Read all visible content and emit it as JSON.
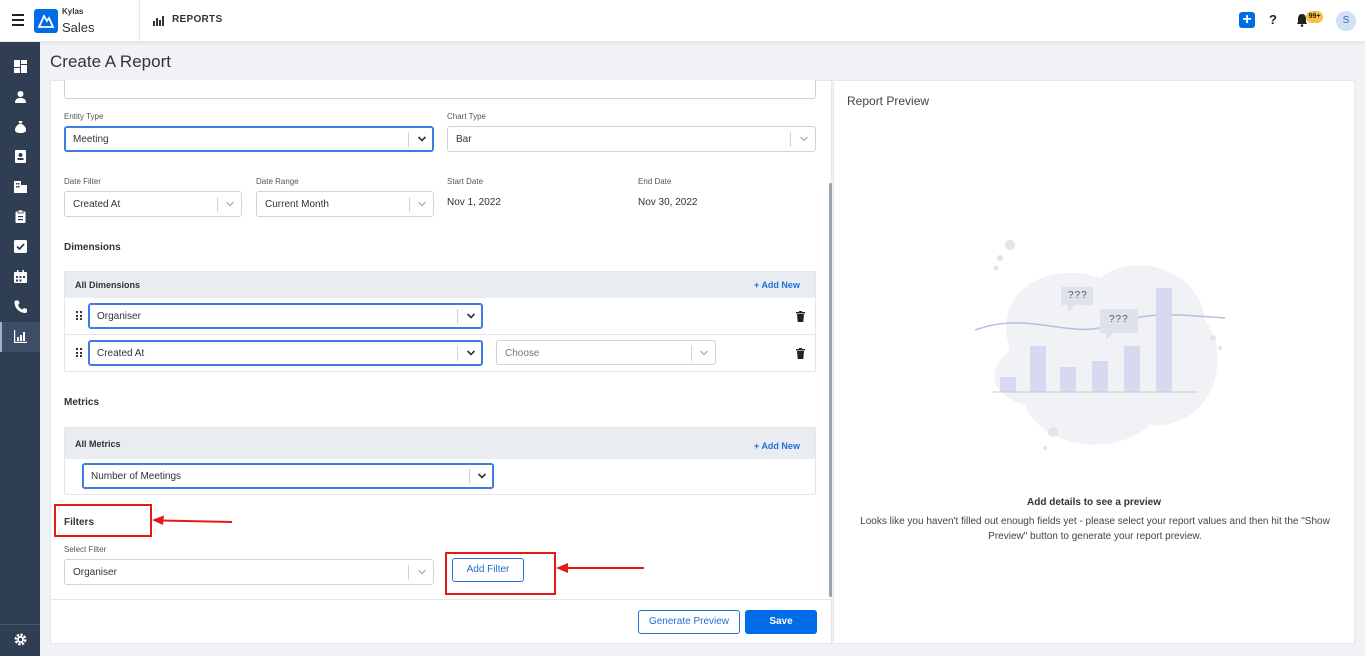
{
  "app": {
    "brand_small": "Kylas",
    "brand_name": "Sales",
    "module": "REPORTS",
    "notification_count": "99+",
    "avatar_initial": "S"
  },
  "sidebar": {
    "items": [
      "dashboard-icon",
      "user-icon",
      "money-bag-icon",
      "contact-card-icon",
      "building-icon",
      "clipboard-icon",
      "checkbox-icon",
      "calendar-icon",
      "phone-icon",
      "reports-icon"
    ],
    "active": "reports-icon",
    "bottom": "gear-icon"
  },
  "page": {
    "title": "Create A Report"
  },
  "form": {
    "entity_type": {
      "label": "Entity Type",
      "value": "Meeting"
    },
    "chart_type": {
      "label": "Chart Type",
      "value": "Bar"
    },
    "date_filter": {
      "label": "Date Filter",
      "value": "Created At"
    },
    "date_range": {
      "label": "Date Range",
      "value": "Current Month"
    },
    "start_date": {
      "label": "Start Date",
      "value": "Nov 1, 2022"
    },
    "end_date": {
      "label": "End Date",
      "value": "Nov 30, 2022"
    },
    "dimensions": {
      "title": "Dimensions",
      "box_title": "All Dimensions",
      "add_new": "Add New",
      "rows": [
        {
          "value": "Organiser"
        },
        {
          "value": "Created At",
          "secondary_placeholder": "Choose"
        }
      ]
    },
    "metrics": {
      "title": "Metrics",
      "box_title": "All Metrics",
      "add_new": "Add New",
      "value": "Number of Meetings"
    },
    "filters": {
      "title": "Filters",
      "select_label": "Select Filter",
      "select_value": "Organiser",
      "add_filter": "Add Filter"
    },
    "actions": {
      "generate_preview": "Generate Preview",
      "save": "Save"
    }
  },
  "preview": {
    "title": "Report Preview",
    "question_marks_1": "???",
    "question_marks_2": "???",
    "heading": "Add details to see a preview",
    "description": "Looks like you haven't filled out enough fields yet - please select your report values and then hit the \"Show Preview\" button to generate your report preview."
  },
  "colors": {
    "accent": "#006de6",
    "sidebar": "#2f3e53",
    "annotation": "#e61919"
  }
}
